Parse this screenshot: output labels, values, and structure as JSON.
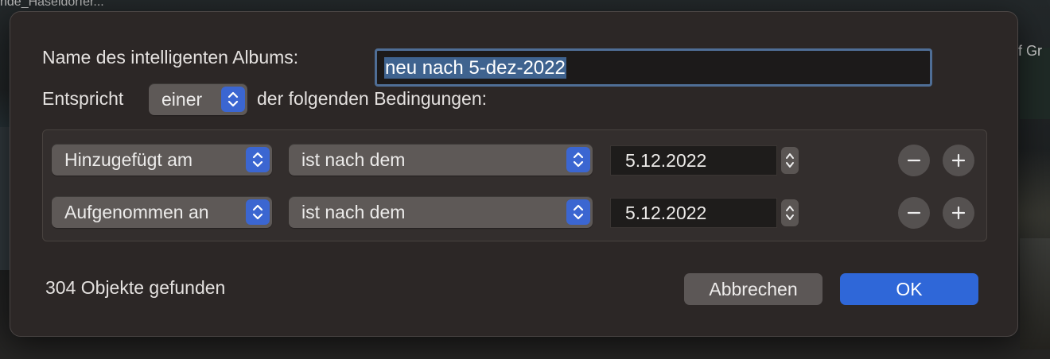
{
  "background": {
    "top_left_text": "nde_Haseldorfer...",
    "right_text": "f Gr"
  },
  "dialog": {
    "name_label": "Name des intelligenten Albums:",
    "name_value": "neu nach 5-dez-2022",
    "match_prefix": "Entspricht",
    "match_selected": "einer",
    "match_suffix": "der folgenden Bedingungen:",
    "rules": [
      {
        "field": "Hinzugefügt am",
        "operator": "ist nach dem",
        "value": "5.12.2022"
      },
      {
        "field": "Aufgenommen an",
        "operator": "ist nach dem",
        "value": "5.12.2022"
      }
    ],
    "result_count": "304 Objekte gefunden",
    "cancel_label": "Abbrechen",
    "ok_label": "OK"
  },
  "colors": {
    "dialog_bg": "#2c2726",
    "accent": "#2f67d8",
    "popup_bg": "#5e5957",
    "selection": "#3f638f"
  },
  "icons": {
    "popup_arrows": "chevron-up-down-icon",
    "stepper": "stepper-arrows-icon",
    "remove": "minus-icon",
    "add": "plus-icon"
  }
}
